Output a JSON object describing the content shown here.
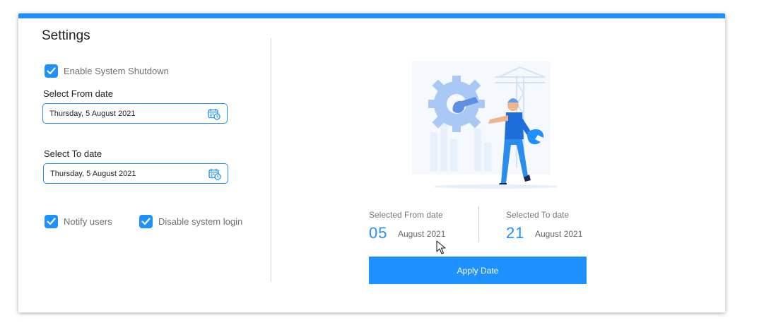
{
  "settings": {
    "title": "Settings",
    "enable_shutdown_label": "Enable System Shutdown",
    "from_label": "Select From date",
    "from_value": "Thursday, 5 August 2021",
    "to_label": "Select To date",
    "to_value": "Thursday, 5 August 2021",
    "notify_label": "Notify users",
    "disable_login_label": "Disable system login",
    "checkboxes": {
      "enable_shutdown": true,
      "notify": true,
      "disable_login": true
    }
  },
  "summary": {
    "from_title": "Selected From date",
    "from_day": "05",
    "from_month": "August 2021",
    "to_title": "Selected To date",
    "to_day": "21",
    "to_month": "August 2021",
    "apply_label": "Apply Date"
  },
  "icons": {
    "checkbox": "check-icon",
    "calendar": "calendar-icon",
    "illustration": "maintenance-illustration"
  },
  "colors": {
    "accent": "#1e90ff"
  }
}
